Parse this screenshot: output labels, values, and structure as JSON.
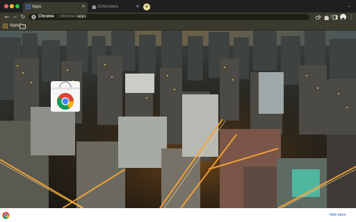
{
  "window": {
    "controls": [
      "close",
      "minimize",
      "maximize"
    ]
  },
  "tabs": [
    {
      "label": "Apps",
      "icon": "apps-grid-icon",
      "active": true
    },
    {
      "label": "Extensions",
      "icon": "puzzle-icon",
      "active": false
    }
  ],
  "toolbar": {
    "site_label": "Chrome",
    "url_scheme": "chrome://",
    "url_path": "apps"
  },
  "bookmarks": {
    "apps_label": "Apps"
  },
  "apps": [
    {
      "icon": "chrome-web-store-icon"
    }
  ],
  "footer": {
    "web_store_label": "Web Store"
  },
  "theme": {
    "frame": "#3b3a2f",
    "tabstrip": "#1f1f1f",
    "new_tab_button": "#f3e7a3",
    "footer_link": "#1a56c4"
  }
}
